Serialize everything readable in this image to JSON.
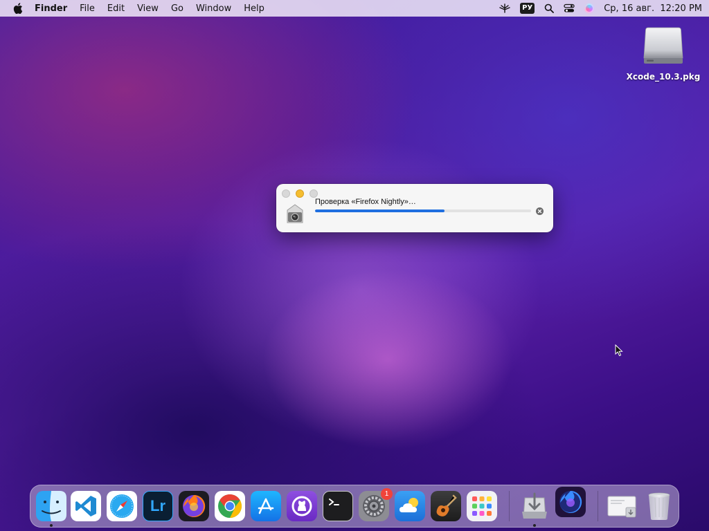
{
  "menubar": {
    "app_name": "Finder",
    "items": [
      "File",
      "Edit",
      "View",
      "Go",
      "Window",
      "Help"
    ],
    "input_source": "РУ",
    "datetime": "Ср, 16 авг.  12:20 PM",
    "icons": [
      "apple-icon",
      "network-icon",
      "spotlight-search-icon",
      "control-center-icon",
      "siri-icon"
    ]
  },
  "desktop": {
    "items": [
      {
        "label": "Xcode_10.3.pkg",
        "icon": "disk-image-icon"
      }
    ]
  },
  "verify_window": {
    "message": "Проверка «Firefox Nightly»…",
    "progress": 0.6,
    "colors": {
      "progress": "#1f6fe0",
      "minimize": "#f5bd30"
    },
    "icons": [
      "gatekeeper-icon",
      "stop-icon"
    ]
  },
  "dock": {
    "apps": [
      {
        "icon": "finder-icon",
        "running": true
      },
      {
        "icon": "vscode-icon",
        "running": false
      },
      {
        "icon": "safari-icon",
        "running": false
      },
      {
        "icon": "lightroom-icon",
        "label": "Lr",
        "running": false
      },
      {
        "icon": "firefox-icon",
        "running": false
      },
      {
        "icon": "chrome-icon",
        "running": false
      },
      {
        "icon": "app-store-icon",
        "running": false
      },
      {
        "icon": "github-desktop-icon",
        "running": false
      },
      {
        "icon": "terminal-icon",
        "running": false
      },
      {
        "icon": "system-preferences-icon",
        "badge": "1",
        "running": false
      },
      {
        "icon": "weather-icon",
        "running": false
      },
      {
        "icon": "garageband-icon",
        "running": false
      },
      {
        "icon": "launchpad-icon",
        "running": false
      },
      {
        "icon": "installer-icon",
        "running": true
      },
      {
        "icon": "firefox-nightly-icon",
        "running": false
      },
      {
        "icon": "downloads-stack-icon",
        "running": false
      },
      {
        "icon": "trash-icon",
        "running": false
      }
    ]
  }
}
